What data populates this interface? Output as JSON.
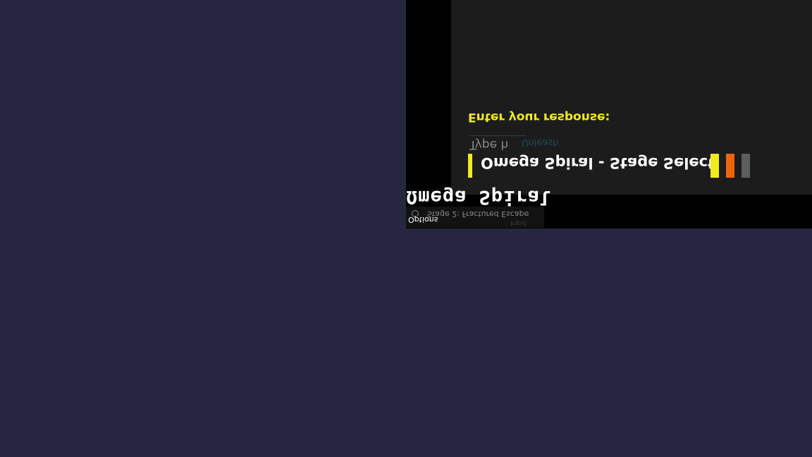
{
  "dialog": {
    "prompt": "Enter your response:",
    "input_placeholder": "Type h",
    "submit_label": "Unleash",
    "title": "Omega Spiral - Stage Select"
  },
  "colors": {
    "accent_yellow": "#f2ea1a",
    "accent_orange": "#f06410",
    "accent_gray": "#5e5e5e",
    "background": "#262641"
  },
  "game": {
    "logo": "Ωmega Spiral",
    "stages": [
      "Stage 2: Fractured Escape"
    ],
    "options_label": "Options",
    "footer_label": "Input"
  }
}
